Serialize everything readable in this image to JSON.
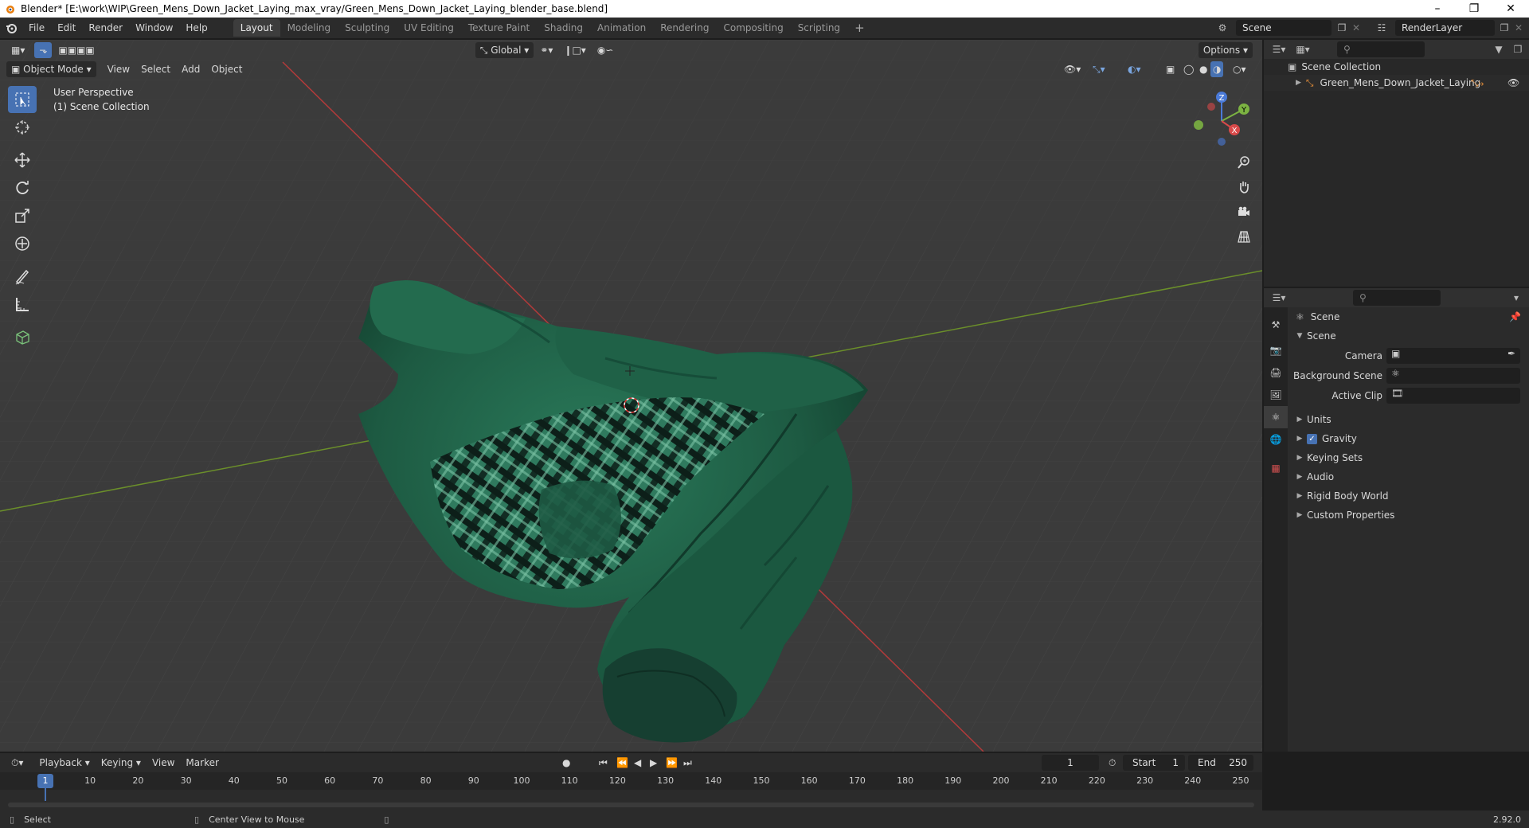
{
  "window": {
    "title": "Blender* [E:\\work\\WIP\\Green_Mens_Down_Jacket_Laying_max_vray/Green_Mens_Down_Jacket_Laying_blender_base.blend]"
  },
  "menu": [
    "File",
    "Edit",
    "Render",
    "Window",
    "Help"
  ],
  "workspaces": [
    {
      "label": "Layout",
      "active": true
    },
    {
      "label": "Modeling"
    },
    {
      "label": "Sculpting"
    },
    {
      "label": "UV Editing"
    },
    {
      "label": "Texture Paint"
    },
    {
      "label": "Shading"
    },
    {
      "label": "Animation"
    },
    {
      "label": "Rendering"
    },
    {
      "label": "Compositing"
    },
    {
      "label": "Scripting"
    }
  ],
  "scene_name": "Scene",
  "render_layer": "RenderLayer",
  "viewport": {
    "transform_orientation": "Global",
    "options_label": "Options",
    "mode": "Object Mode",
    "menus": [
      "View",
      "Select",
      "Add",
      "Object"
    ],
    "overlay_line1": "User Perspective",
    "overlay_line2": "(1) Scene Collection",
    "gizmo": {
      "z": "Z",
      "y": "Y",
      "x": "X"
    }
  },
  "outliner": {
    "root": "Scene Collection",
    "items": [
      "Green_Mens_Down_Jacket_Laying"
    ]
  },
  "properties": {
    "context": "Scene",
    "panel_title": "Scene",
    "fields": [
      {
        "label": "Camera"
      },
      {
        "label": "Background Scene"
      },
      {
        "label": "Active Clip"
      }
    ],
    "sections": [
      {
        "label": "Units"
      },
      {
        "label": "Gravity",
        "checked": true
      },
      {
        "label": "Keying Sets"
      },
      {
        "label": "Audio"
      },
      {
        "label": "Rigid Body World"
      },
      {
        "label": "Custom Properties"
      }
    ]
  },
  "timeline": {
    "menus": [
      "Playback",
      "Keying",
      "View",
      "Marker"
    ],
    "current_frame": "1",
    "start_label": "Start",
    "start": "1",
    "end_label": "End",
    "end": "250",
    "ruler": [
      "1",
      "10",
      "20",
      "30",
      "40",
      "50",
      "60",
      "70",
      "80",
      "90",
      "100",
      "110",
      "120",
      "130",
      "140",
      "150",
      "160",
      "170",
      "180",
      "190",
      "200",
      "210",
      "220",
      "230",
      "240",
      "250"
    ]
  },
  "status": {
    "select": "Select",
    "center_view": "Center View to Mouse",
    "version": "2.92.0"
  },
  "colors": {
    "accent": "#4772b3",
    "jacket": "#1f5e45",
    "x_axis": "#c83232",
    "y_axis": "#6b9a2a"
  }
}
